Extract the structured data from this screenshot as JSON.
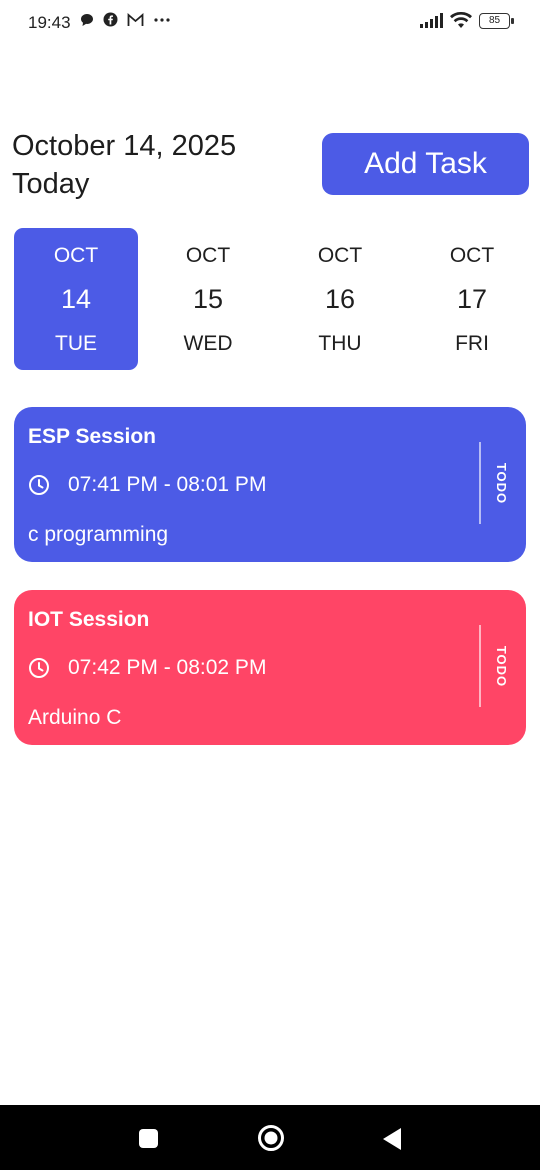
{
  "status_bar": {
    "time": "19:43",
    "battery": "85"
  },
  "header": {
    "date": "October 14, 2025",
    "subtitle": "Today",
    "add_task_label": "Add Task"
  },
  "date_strip": [
    {
      "month": "OCT",
      "day": "14",
      "weekday": "TUE",
      "selected": true
    },
    {
      "month": "OCT",
      "day": "15",
      "weekday": "WED",
      "selected": false
    },
    {
      "month": "OCT",
      "day": "16",
      "weekday": "THU",
      "selected": false
    },
    {
      "month": "OCT",
      "day": "17",
      "weekday": "FRI",
      "selected": false
    }
  ],
  "tasks": [
    {
      "title": "ESP Session",
      "time": "07:41 PM - 08:01 PM",
      "note": "c programming",
      "status": "TODO",
      "color": "#4c5be6"
    },
    {
      "title": "IOT Session",
      "time": "07:42 PM - 08:02 PM",
      "note": "Arduino C",
      "status": "TODO",
      "color": "#ff4566"
    }
  ],
  "colors": {
    "accent": "#4c5be6",
    "task_red": "#ff4566"
  },
  "icons": {
    "theme_toggle": "moon-icon",
    "clock": "clock-icon",
    "nav": [
      "recents-square-icon",
      "home-circle-icon",
      "back-triangle-icon"
    ]
  }
}
